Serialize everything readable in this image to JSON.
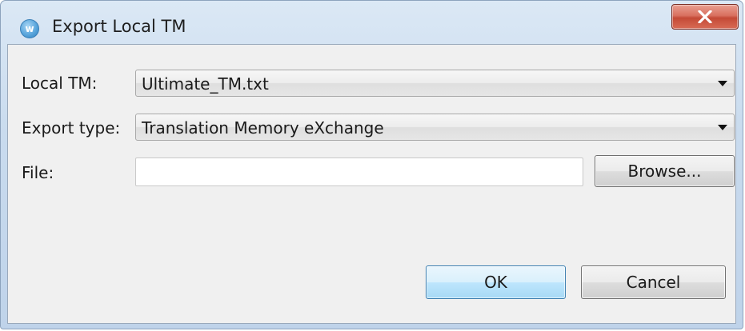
{
  "window": {
    "title": "Export Local TM",
    "app_icon_glyph": "w",
    "close_icon": "close-x-icon"
  },
  "form": {
    "local_tm_label": "Local TM:",
    "local_tm_value": "Ultimate_TM.txt",
    "export_type_label": "Export type:",
    "export_type_value": "Translation Memory eXchange",
    "file_label": "File:",
    "file_value": "",
    "browse_label": "Browse..."
  },
  "buttons": {
    "ok_label": "OK",
    "cancel_label": "Cancel"
  },
  "colors": {
    "titlebar": "#c9dbee",
    "close_button": "#c44a36",
    "client_background": "#f0f0f0",
    "default_button": "#bee6fd"
  }
}
